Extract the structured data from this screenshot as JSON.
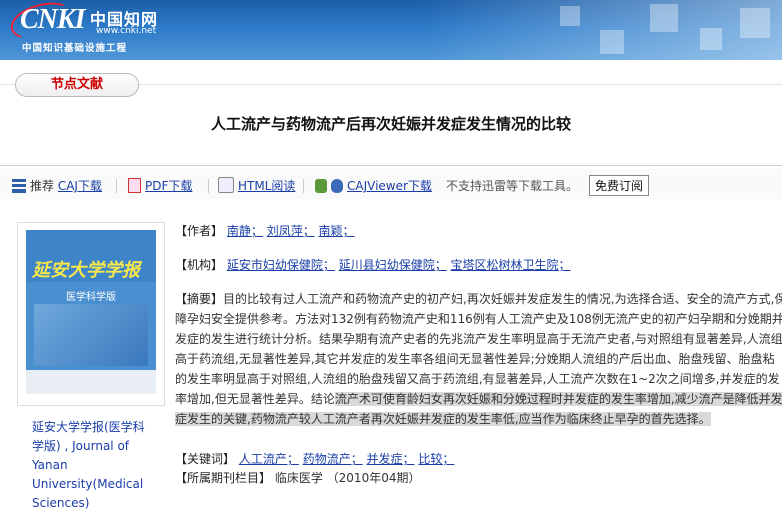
{
  "header": {
    "logo_cnki": "CNKI",
    "logo_cn": "中国知网",
    "logo_url": "www.cnki.net",
    "logo_sub": "中国知识基础设施工程"
  },
  "node_tag": "节点文献",
  "title": "人工流产与药物流产后再次妊娠并发症发生情况的比较",
  "toolbar": {
    "recommend": "推荐",
    "caj": "CAJ下载",
    "pdf": "PDF下载",
    "html": "HTML阅读",
    "viewer": "CAJViewer下载",
    "notice": "不支持迅雷等下载工具。",
    "subscribe": "免费订阅"
  },
  "cover": {
    "title": "延安大学学报",
    "subtitle": "医学科学版"
  },
  "journal_name": [
    "延安大学学报(医学科",
    "学版) , Journal of",
    "Yanan",
    "University(Medical",
    "Sciences)"
  ],
  "authors": {
    "label": "【作者】",
    "items": [
      "南静；",
      "刘凤萍；",
      "南颖；"
    ]
  },
  "orgs": {
    "label": "【机构】",
    "items": [
      "延安市妇幼保健院；",
      "延川县妇幼保健院；",
      "宝塔区松树林卫生院；"
    ]
  },
  "abstract": {
    "label": "【摘要】",
    "lines": [
      "目的比较有过人工流产和药物流产史的初产妇,再次妊娠并发症发生的情况,为选择合适、安全的流产方式,保",
      "障孕妇安全提供参考。方法对132例有药物流产史和116例有人工流产史及108例无流产史的初产妇孕期和分娩期并",
      "发症的发生进行统计分析。结果孕期有流产史者的先兆流产发生率明显高于无流产史者,与对照组有显著差异,人流组",
      "高于药流组,无显著性差异,其它并发症的发生率各组间无显著性差异;分娩期人流组的产后出血、胎盘残留、胎盘粘",
      "的发生率明显高于对照组,人流组的胎盘残留又高于药流组,有显著差异,人工流产次数在1~2次之间增多,并发症的发",
      "率增加,但无显著性差异。结论",
      "症发生的关键,药物流产较人工流产者再次妊娠并发症的发生率低,应当作为临床终止早孕的首先选择。"
    ],
    "line6_highlight": "流产术可使育龄妇女再次妊娠和分娩过程时并发症的发生率增加,减少流产是降低并发"
  },
  "keywords": {
    "label": "【关键词】",
    "items": [
      "人工流产；",
      "药物流产；",
      "并发症；",
      "比较；"
    ]
  },
  "issue": {
    "label": "【所属期刊栏目】",
    "value": "临床医学 （2010年04期）"
  },
  "colors": {
    "banner": "#2d7ac8",
    "link": "#1a3ea8",
    "node_tag": "#cc0000",
    "highlight": "#d9d9d9"
  }
}
